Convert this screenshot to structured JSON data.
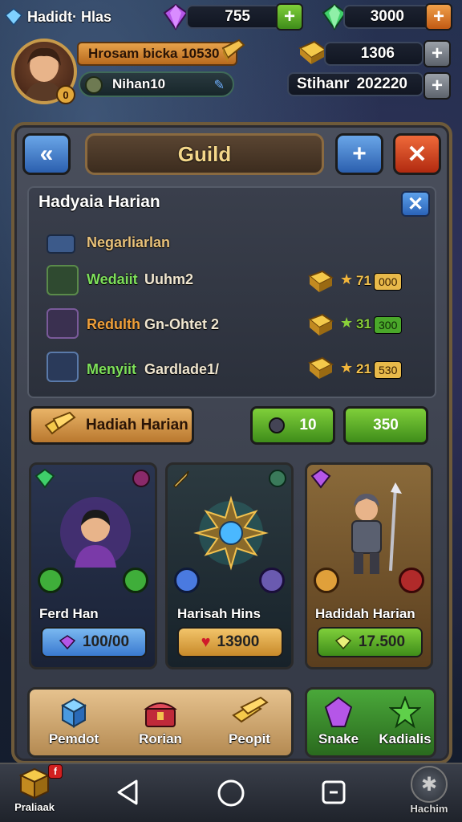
{
  "topbar": {
    "brand": "Hadidt· Hlas",
    "gems": "755",
    "emeralds": "3000"
  },
  "profile": {
    "name_plate": "Hrosam bicka 10530",
    "sub_plate": "Nihan10",
    "level_badge": "0"
  },
  "resources": {
    "gold": "1306",
    "silver_label": "Stihanr",
    "silver": "202220"
  },
  "panel": {
    "title": "Guild",
    "section_title": "Hadyaia Harian",
    "header_item": "Negarliarlan",
    "rows": [
      {
        "name": "Wedaiit",
        "desc": "Uuhm2",
        "stars": "71",
        "chip": "000"
      },
      {
        "name": "Redulth",
        "desc": "Gn-Ohtet 2",
        "stars": "31",
        "chip": "300"
      },
      {
        "name": "Menyiit",
        "desc": "Gardlade1/",
        "stars": "21",
        "chip": "530"
      }
    ],
    "claim_button": "Hadiah Harian",
    "counter_a": "10",
    "counter_b": "350"
  },
  "cards": [
    {
      "name": "Ferd Han",
      "price": "100/00"
    },
    {
      "name": "Harisah Hins",
      "price": "13900"
    },
    {
      "name": "Hadidah Harian",
      "price": "17.500"
    }
  ],
  "tray": [
    {
      "label": "Pemdot"
    },
    {
      "label": "Rorian"
    },
    {
      "label": "Peopit"
    }
  ],
  "tray_right": [
    {
      "label": "Snake"
    },
    {
      "label": "Kadialis"
    }
  ],
  "navbar": {
    "left_label": "Praliaak",
    "left_badge": "f",
    "right_label": "Hachim"
  },
  "colors": {
    "gold_accent": "#c79a4b",
    "green_button": "#4f9d24",
    "blue_button": "#2b5fae",
    "red_button": "#b12a10"
  }
}
